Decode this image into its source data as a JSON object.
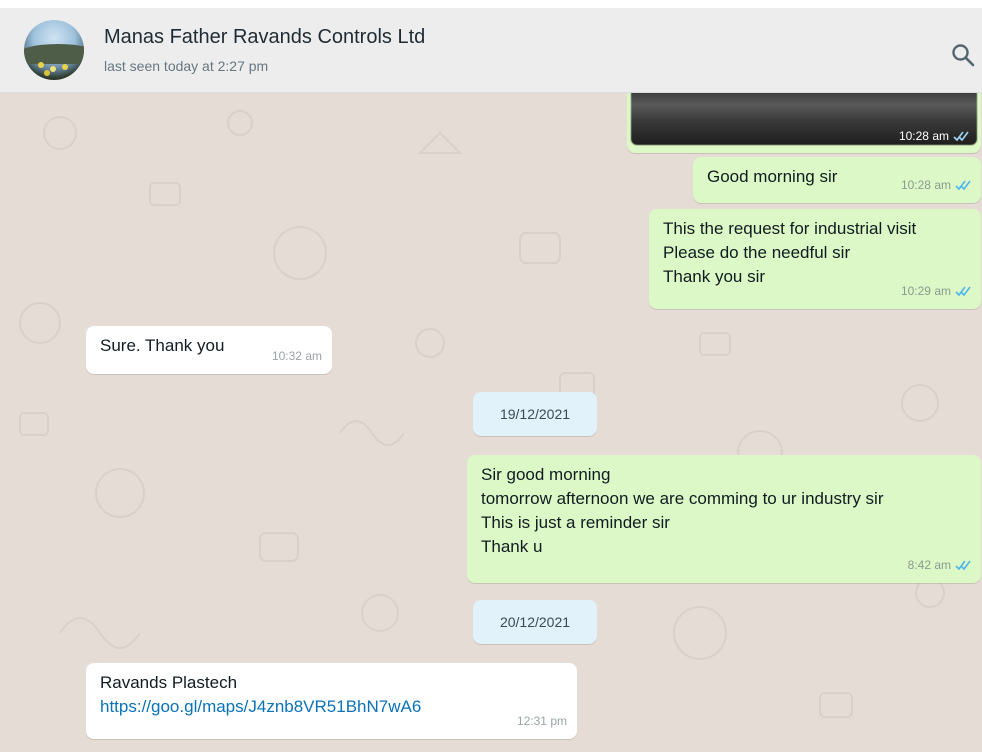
{
  "header": {
    "contact_name": "Manas Father Ravands Controls Ltd",
    "status": "last seen today at 2:27 pm",
    "search_icon": "search-icon"
  },
  "colors": {
    "outgoing_bubble": "#dcf8c6",
    "incoming_bubble": "#ffffff",
    "date_chip": "#e1f2fb",
    "chat_background": "#e5ddd5",
    "read_ticks": "#4fb6ec",
    "link": "#0a72b8"
  },
  "messages": [
    {
      "direction": "out",
      "type": "image",
      "time": "10:28 am",
      "status_icon": "double-check-icon"
    },
    {
      "direction": "out",
      "text": "Good morning sir",
      "time": "10:28 am",
      "status_icon": "double-check-icon"
    },
    {
      "direction": "out",
      "text": "This the request for industrial visit\nPlease do the needful sir\nThank you sir",
      "time": "10:29 am",
      "status_icon": "double-check-icon"
    },
    {
      "direction": "in",
      "text": "Sure. Thank you",
      "time": "10:32 am"
    },
    {
      "direction": "out",
      "text": "Sir good morning\ntomorrow afternoon we are comming to ur industry sir\nThis is just a reminder sir\nThank u",
      "time": "8:42 am",
      "status_icon": "double-check-icon"
    },
    {
      "direction": "in",
      "text": "Ravands Plastech",
      "link": "https://goo.gl/maps/J4znb8VR51BhN7wA6",
      "time": "12:31 pm"
    }
  ],
  "date_separators": [
    "19/12/2021",
    "20/12/2021"
  ]
}
